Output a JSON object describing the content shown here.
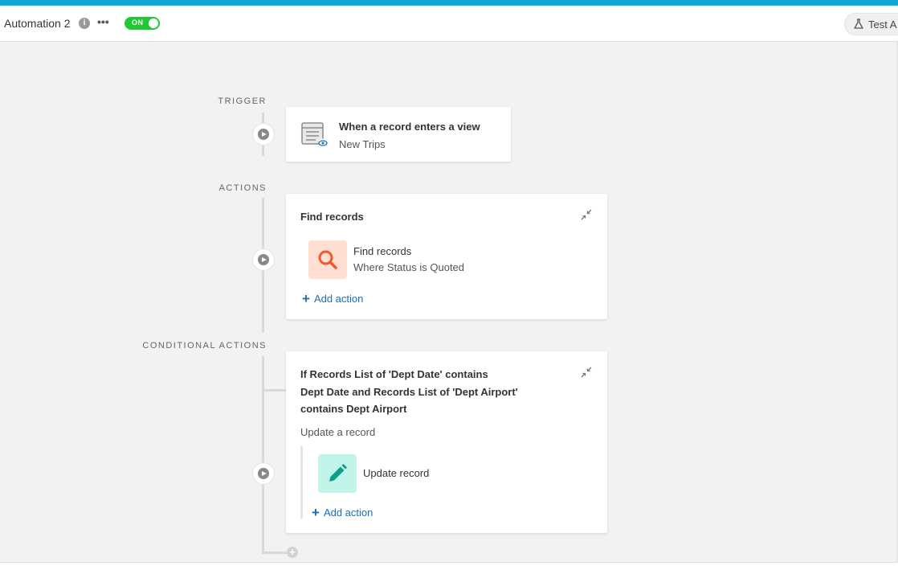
{
  "header": {
    "title": "Automation 2",
    "toggle_label": "ON",
    "test_button_label": "Test A"
  },
  "trigger": {
    "section_label": "TRIGGER",
    "title": "When a record enters a view",
    "subtitle": "New Trips",
    "icon": "table-view-icon"
  },
  "actions": {
    "section_label": "ACTIONS",
    "card_title": "Find records",
    "step": {
      "title": "Find records",
      "subtitle": "Where Status is Quoted",
      "icon": "search-icon",
      "icon_bg": "#ffdfd3",
      "icon_color": "#f05a28"
    },
    "add_action_label": "Add action"
  },
  "conditional": {
    "section_label": "CONDITIONAL ACTIONS",
    "condition_lines": [
      "If Records List of 'Dept Date' contains",
      "Dept Date and Records List of 'Dept Airport'",
      "contains Dept Airport"
    ],
    "group_label": "Update a record",
    "step": {
      "title": "Update record",
      "icon": "pencil-icon",
      "icon_bg": "#c2f5e9",
      "icon_color": "#0b9e8a"
    },
    "add_action_label": "Add action"
  },
  "colors": {
    "accent_bar": "#0fa8d9",
    "toggle_on": "#20c933",
    "link": "#1a6fb5"
  }
}
